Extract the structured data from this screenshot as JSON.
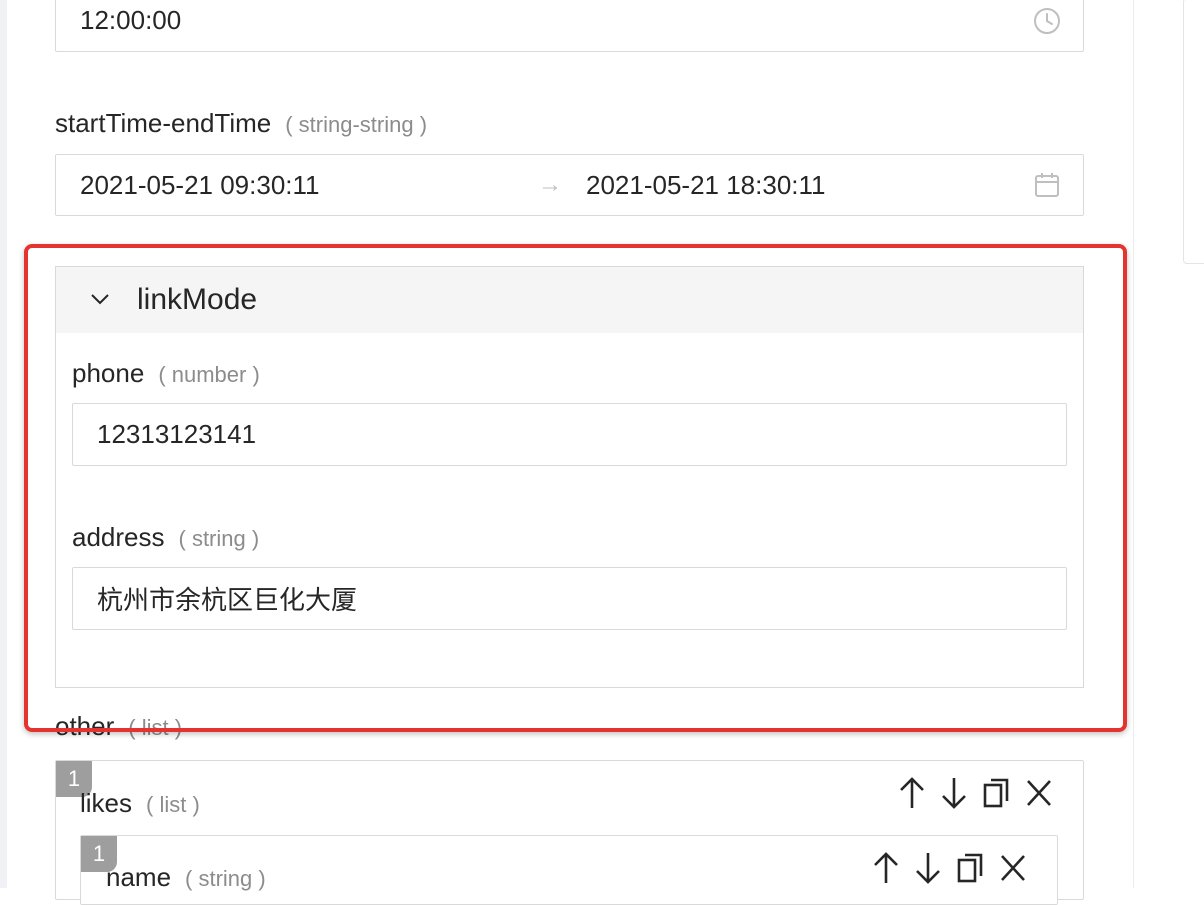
{
  "time_field": {
    "value": "12:00:00",
    "icon": "clock-icon"
  },
  "range_field": {
    "label": "startTime-endTime",
    "type": "( string-string )",
    "start": "2021-05-21 09:30:11",
    "separator": "→",
    "end": "2021-05-21 18:30:11",
    "icon": "calendar-icon"
  },
  "link_mode": {
    "title": "linkMode",
    "phone": {
      "label": "phone",
      "type": "( number )",
      "value": "12313123141"
    },
    "address": {
      "label": "address",
      "type": "( string )",
      "value": "杭州市余杭区巨化大厦"
    }
  },
  "other": {
    "label": "other",
    "type": "( list )",
    "item_index": "1",
    "likes": {
      "label": "likes",
      "type": "( list )",
      "item_index": "1",
      "name": {
        "label": "name",
        "type": "( string )"
      }
    }
  },
  "colors": {
    "highlight": "#e3342f",
    "border": "#d9d9d9",
    "muted": "#8c8c8c"
  }
}
